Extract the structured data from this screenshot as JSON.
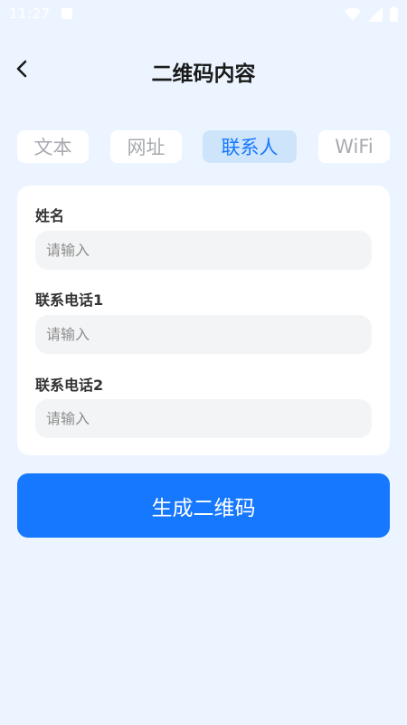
{
  "status_bar": {
    "time": "11:27"
  },
  "header": {
    "back_icon": "chevron-left-icon",
    "title": "二维码内容"
  },
  "tabs": [
    {
      "label": "文本",
      "active": false
    },
    {
      "label": "网址",
      "active": false
    },
    {
      "label": "联系人",
      "active": true
    },
    {
      "label": "WiFi",
      "active": false
    }
  ],
  "form": {
    "fields": [
      {
        "label": "姓名",
        "placeholder": "请输入",
        "value": ""
      },
      {
        "label": "联系电话1",
        "placeholder": "请输入",
        "value": ""
      },
      {
        "label": "联系电话2",
        "placeholder": "请输入",
        "value": ""
      }
    ]
  },
  "actions": {
    "generate_label": "生成二维码"
  },
  "colors": {
    "background": "#ecf5ff",
    "accent": "#1677ff",
    "active_tab_bg": "#cde4fb",
    "inactive_tab_text": "#a8aab0"
  }
}
